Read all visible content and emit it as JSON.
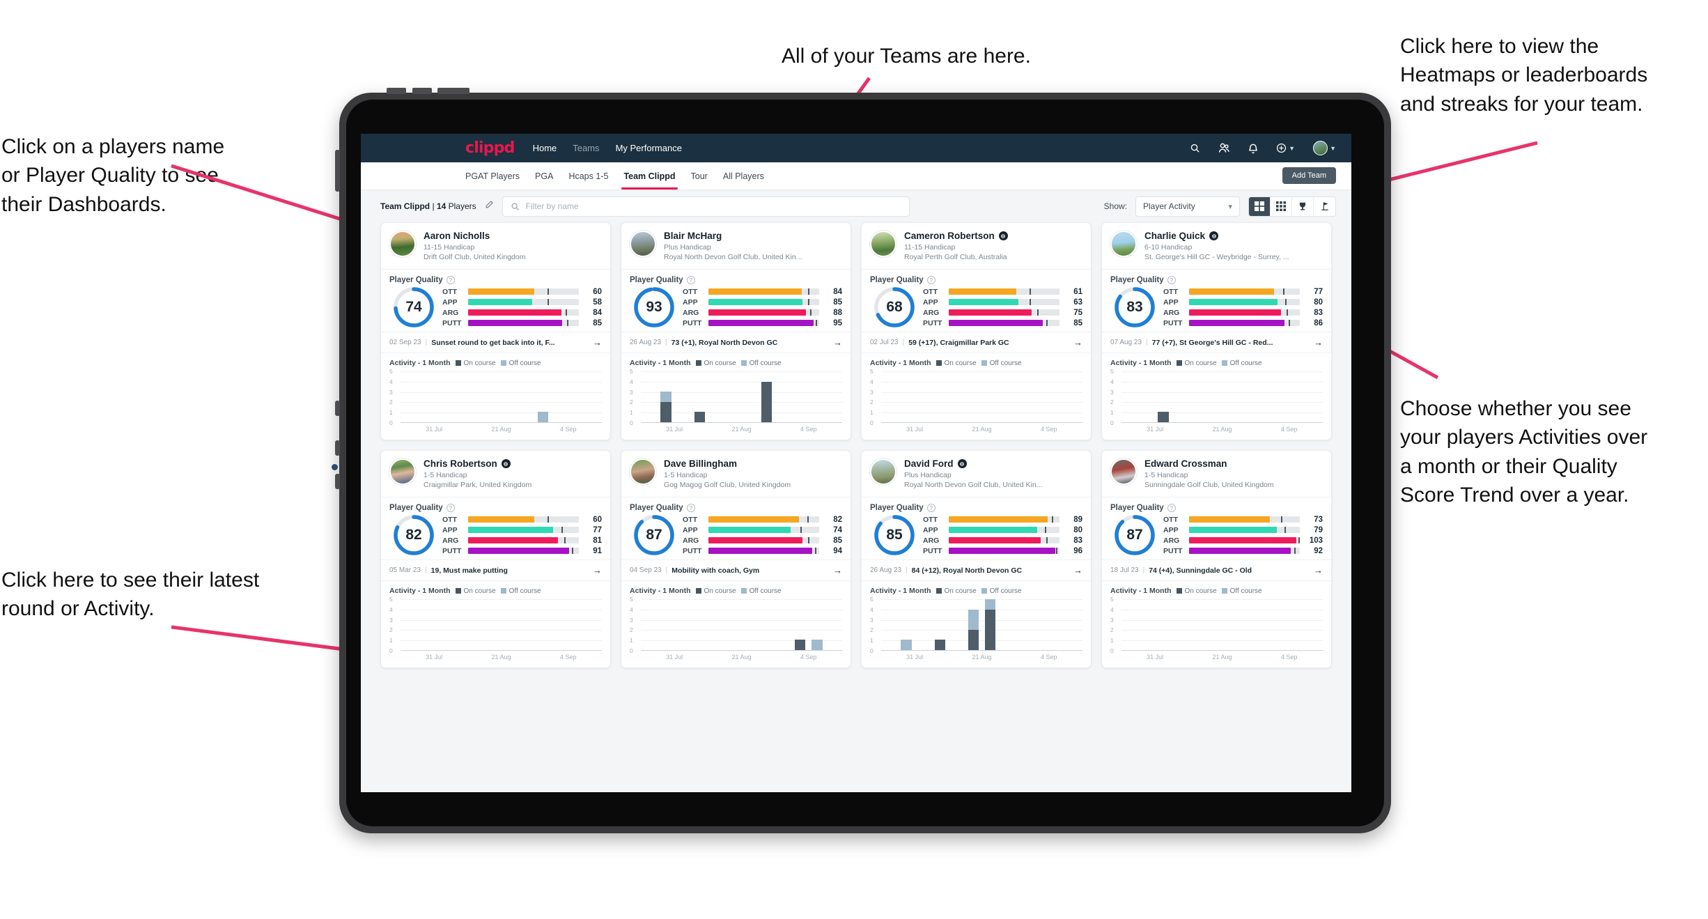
{
  "annotations": {
    "top": "All of your Teams are here.",
    "right_top": "Click here to view the\nHeatmaps or leaderboards\nand streaks for your team.",
    "left_top": "Click on a players name\nor Player Quality to see\ntheir Dashboards.",
    "right_bottom": "Choose whether you see\nyour players Activities over\na month or their Quality\nScore Trend over a year.",
    "left_bottom": "Click here to see their latest\nround or Activity.",
    "arrow_color": "#e8336a"
  },
  "navbar": {
    "brand": "clippd",
    "links": [
      {
        "label": "Home",
        "active": true
      },
      {
        "label": "Teams",
        "active": false
      },
      {
        "label": "My Performance",
        "active": true
      }
    ],
    "icons": [
      "search-icon",
      "people-icon",
      "bell-icon",
      "plus-circle-icon",
      "avatar"
    ]
  },
  "subtabs": {
    "items": [
      {
        "label": "PGAT Players",
        "active": false
      },
      {
        "label": "PGA",
        "active": false
      },
      {
        "label": "Hcaps 1-5",
        "active": false
      },
      {
        "label": "Team Clippd",
        "active": true
      },
      {
        "label": "Tour",
        "active": false
      },
      {
        "label": "All Players",
        "active": false
      }
    ],
    "add_team_label": "Add Team"
  },
  "filterbar": {
    "team_name": "Team Clippd",
    "separator": "|",
    "player_count": "14",
    "players_word": "Players",
    "edit_icon": "pencil-icon",
    "search_placeholder": "Filter by name",
    "show_label": "Show:",
    "show_value": "Player Activity",
    "view_toggles": [
      {
        "icon": "grid-large-icon",
        "active": true
      },
      {
        "icon": "grid-small-icon",
        "active": false
      },
      {
        "icon": "trophy-icon",
        "active": false
      },
      {
        "icon": "flag-icon",
        "active": false
      }
    ]
  },
  "card_labels": {
    "quality_title": "Player Quality",
    "activity_title": "Activity - 1 Month",
    "legend_on": "On course",
    "legend_off": "Off course",
    "bar_labels": [
      "OTT",
      "APP",
      "ARG",
      "PUTT"
    ],
    "y_ticks": [
      "5",
      "4",
      "3",
      "2",
      "1",
      "0"
    ],
    "x_ticks": [
      "31 Jul",
      "21 Aug",
      "4 Sep"
    ]
  },
  "colors": {
    "ott": "#f5a623",
    "app": "#2fd9b3",
    "arg": "#ef1c5c",
    "putt": "#a612c4",
    "ring": "#1f7fd4",
    "on_course": "#4e5d68",
    "off_course": "#9fb9cd",
    "accent": "#e8174e"
  },
  "chart_data": {
    "type": "bar",
    "title": "Activity - 1 Month",
    "ylabel": "",
    "xlabel": "",
    "ylim": [
      0,
      5
    ],
    "grid": true,
    "legend": [
      "On course",
      "Off course"
    ],
    "categories": [
      "31 Jul",
      "21 Aug",
      "4 Sep"
    ]
  },
  "players": [
    {
      "name": "Aaron Nicholls",
      "verified": false,
      "handicap": "11-15 Handicap",
      "club": "Drift Golf Club, United Kingdom",
      "quality": "74",
      "ring_pct": 74,
      "bars": [
        {
          "label": "OTT",
          "value": "60",
          "pct": 60,
          "tick": 72
        },
        {
          "label": "APP",
          "value": "58",
          "pct": 58,
          "tick": 72
        },
        {
          "label": "ARG",
          "value": "84",
          "pct": 84,
          "tick": 88
        },
        {
          "label": "PUTT",
          "value": "85",
          "pct": 85,
          "tick": 89
        }
      ],
      "round_date": "02 Sep 23",
      "round_text": "Sunset round to get back into it, F...",
      "activity": {
        "on": [
          0,
          0,
          0,
          0,
          0,
          0,
          0,
          0,
          0,
          0,
          0,
          0
        ],
        "off": [
          0,
          0,
          0,
          0,
          0,
          0,
          0,
          0,
          1,
          0,
          0,
          0
        ]
      }
    },
    {
      "name": "Blair McHarg",
      "verified": false,
      "handicap": "Plus Handicap",
      "club": "Royal North Devon Golf Club, United Kin...",
      "quality": "93",
      "ring_pct": 97,
      "bars": [
        {
          "label": "OTT",
          "value": "84",
          "pct": 84,
          "tick": 90
        },
        {
          "label": "APP",
          "value": "85",
          "pct": 85,
          "tick": 90
        },
        {
          "label": "ARG",
          "value": "88",
          "pct": 88,
          "tick": 92
        },
        {
          "label": "PUTT",
          "value": "95",
          "pct": 95,
          "tick": 97
        }
      ],
      "round_date": "26 Aug 23",
      "round_text": "73 (+1), Royal North Devon GC",
      "activity": {
        "on": [
          0,
          2,
          0,
          1,
          0,
          0,
          0,
          4,
          0,
          0,
          0,
          0
        ],
        "off": [
          0,
          1,
          0,
          0,
          0,
          0,
          0,
          0,
          0,
          0,
          0,
          0
        ]
      }
    },
    {
      "name": "Cameron Robertson",
      "verified": true,
      "handicap": "11-15 Handicap",
      "club": "Royal Perth Golf Club, Australia",
      "quality": "68",
      "ring_pct": 68,
      "bars": [
        {
          "label": "OTT",
          "value": "61",
          "pct": 61,
          "tick": 73
        },
        {
          "label": "APP",
          "value": "63",
          "pct": 63,
          "tick": 73
        },
        {
          "label": "ARG",
          "value": "75",
          "pct": 75,
          "tick": 80
        },
        {
          "label": "PUTT",
          "value": "85",
          "pct": 85,
          "tick": 88
        }
      ],
      "round_date": "02 Jul 23",
      "round_text": "59 (+17), Craigmillar Park GC",
      "activity": {
        "on": [
          0,
          0,
          0,
          0,
          0,
          0,
          0,
          0,
          0,
          0,
          0,
          0
        ],
        "off": [
          0,
          0,
          0,
          0,
          0,
          0,
          0,
          0,
          0,
          0,
          0,
          0
        ]
      }
    },
    {
      "name": "Charlie Quick",
      "verified": true,
      "handicap": "6-10 Handicap",
      "club": "St. George's Hill GC - Weybridge - Surrey, ...",
      "quality": "83",
      "ring_pct": 85,
      "bars": [
        {
          "label": "OTT",
          "value": "77",
          "pct": 77,
          "tick": 85
        },
        {
          "label": "APP",
          "value": "80",
          "pct": 80,
          "tick": 87
        },
        {
          "label": "ARG",
          "value": "83",
          "pct": 83,
          "tick": 88
        },
        {
          "label": "PUTT",
          "value": "86",
          "pct": 86,
          "tick": 90
        }
      ],
      "round_date": "07 Aug 23",
      "round_text": "77 (+7), St George's Hill GC - Red...",
      "activity": {
        "on": [
          0,
          0,
          1,
          0,
          0,
          0,
          0,
          0,
          0,
          0,
          0,
          0
        ],
        "off": [
          0,
          0,
          0,
          0,
          0,
          0,
          0,
          0,
          0,
          0,
          0,
          0
        ]
      }
    },
    {
      "name": "Chris Robertson",
      "verified": true,
      "handicap": "1-5 Handicap",
      "club": "Craigmillar Park, United Kingdom",
      "quality": "82",
      "ring_pct": 82,
      "bars": [
        {
          "label": "OTT",
          "value": "60",
          "pct": 60,
          "tick": 72
        },
        {
          "label": "APP",
          "value": "77",
          "pct": 77,
          "tick": 84
        },
        {
          "label": "ARG",
          "value": "81",
          "pct": 81,
          "tick": 87
        },
        {
          "label": "PUTT",
          "value": "91",
          "pct": 91,
          "tick": 94
        }
      ],
      "round_date": "05 Mar 23",
      "round_text": "19, Must make putting",
      "activity": {
        "on": [
          0,
          0,
          0,
          0,
          0,
          0,
          0,
          0,
          0,
          0,
          0,
          0
        ],
        "off": [
          0,
          0,
          0,
          0,
          0,
          0,
          0,
          0,
          0,
          0,
          0,
          0
        ]
      }
    },
    {
      "name": "Dave Billingham",
      "verified": false,
      "handicap": "1-5 Handicap",
      "club": "Gog Magog Golf Club, United Kingdom",
      "quality": "87",
      "ring_pct": 88,
      "bars": [
        {
          "label": "OTT",
          "value": "82",
          "pct": 82,
          "tick": 89
        },
        {
          "label": "APP",
          "value": "74",
          "pct": 74,
          "tick": 83
        },
        {
          "label": "ARG",
          "value": "85",
          "pct": 85,
          "tick": 90
        },
        {
          "label": "PUTT",
          "value": "94",
          "pct": 94,
          "tick": 96
        }
      ],
      "round_date": "04 Sep 23",
      "round_text": "Mobility with coach, Gym",
      "activity": {
        "on": [
          0,
          0,
          0,
          0,
          0,
          0,
          0,
          0,
          0,
          1,
          0,
          0
        ],
        "off": [
          0,
          0,
          0,
          0,
          0,
          0,
          0,
          0,
          0,
          0,
          1,
          0
        ]
      }
    },
    {
      "name": "David Ford",
      "verified": true,
      "handicap": "Plus Handicap",
      "club": "Royal North Devon Golf Club, United Kin...",
      "quality": "85",
      "ring_pct": 86,
      "bars": [
        {
          "label": "OTT",
          "value": "89",
          "pct": 89,
          "tick": 93
        },
        {
          "label": "APP",
          "value": "80",
          "pct": 80,
          "tick": 87
        },
        {
          "label": "ARG",
          "value": "83",
          "pct": 83,
          "tick": 88
        },
        {
          "label": "PUTT",
          "value": "96",
          "pct": 96,
          "tick": 97
        }
      ],
      "round_date": "26 Aug 23",
      "round_text": "84 (+12), Royal North Devon GC",
      "activity": {
        "on": [
          0,
          0,
          0,
          1,
          0,
          2,
          4,
          0,
          0,
          0,
          0,
          0
        ],
        "off": [
          0,
          1,
          0,
          0,
          0,
          2,
          1,
          0,
          0,
          0,
          0,
          0
        ]
      }
    },
    {
      "name": "Edward Crossman",
      "verified": false,
      "handicap": "1-5 Handicap",
      "club": "Sunningdale Golf Club, United Kingdom",
      "quality": "87",
      "ring_pct": 88,
      "bars": [
        {
          "label": "OTT",
          "value": "73",
          "pct": 73,
          "tick": 83
        },
        {
          "label": "APP",
          "value": "79",
          "pct": 79,
          "tick": 86
        },
        {
          "label": "ARG",
          "value": "103",
          "pct": 97,
          "tick": 99
        },
        {
          "label": "PUTT",
          "value": "92",
          "pct": 92,
          "tick": 95
        }
      ],
      "round_date": "18 Jul 23",
      "round_text": "74 (+4), Sunningdale GC - Old",
      "activity": {
        "on": [
          0,
          0,
          0,
          0,
          0,
          0,
          0,
          0,
          0,
          0,
          0,
          0
        ],
        "off": [
          0,
          0,
          0,
          0,
          0,
          0,
          0,
          0,
          0,
          0,
          0,
          0
        ]
      }
    }
  ]
}
